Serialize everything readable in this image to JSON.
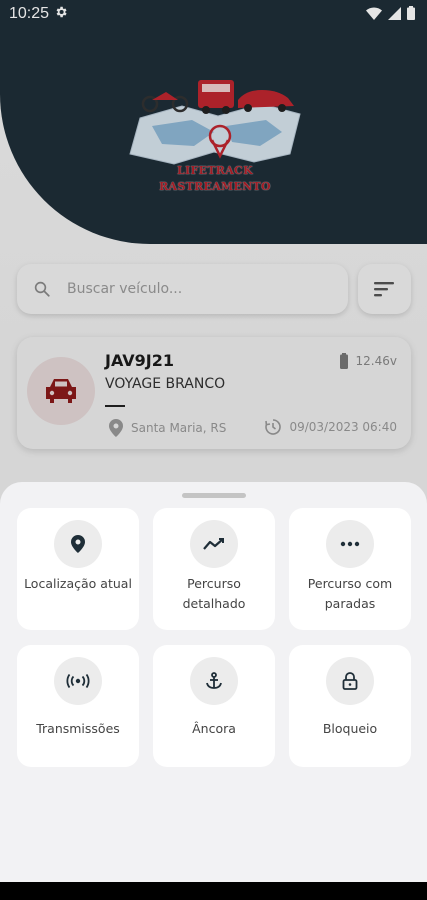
{
  "status_bar": {
    "time": "10:25",
    "icons": [
      "gear-icon",
      "wifi-icon",
      "signal-icon",
      "battery-icon"
    ]
  },
  "logo": {
    "line1": "LIFETRACK",
    "line2": "RASTREAMENTO",
    "color": "#b3202a"
  },
  "search": {
    "placeholder": "Buscar veículo..."
  },
  "vehicle": {
    "plate": "JAV9J21",
    "model": "VOYAGE BRANCO",
    "voltage": "12.46v",
    "location": "Santa Maria, RS",
    "datetime": "09/03/2023 06:40",
    "accent": "#8b1a1a"
  },
  "actions": [
    {
      "label": "Localização atual",
      "icon": "location-pin-icon"
    },
    {
      "label": "Percurso detalhado",
      "icon": "trending-icon"
    },
    {
      "label": "Percurso com paradas",
      "icon": "more-dots-icon"
    },
    {
      "label": "Transmissões",
      "icon": "broadcast-icon"
    },
    {
      "label": "Âncora",
      "icon": "anchor-icon"
    },
    {
      "label": "Bloqueio",
      "icon": "lock-icon"
    }
  ],
  "colors": {
    "header_bg": "#1f2e38",
    "sheet_bg": "#f2f2f4",
    "icon": "#1f2e38"
  }
}
